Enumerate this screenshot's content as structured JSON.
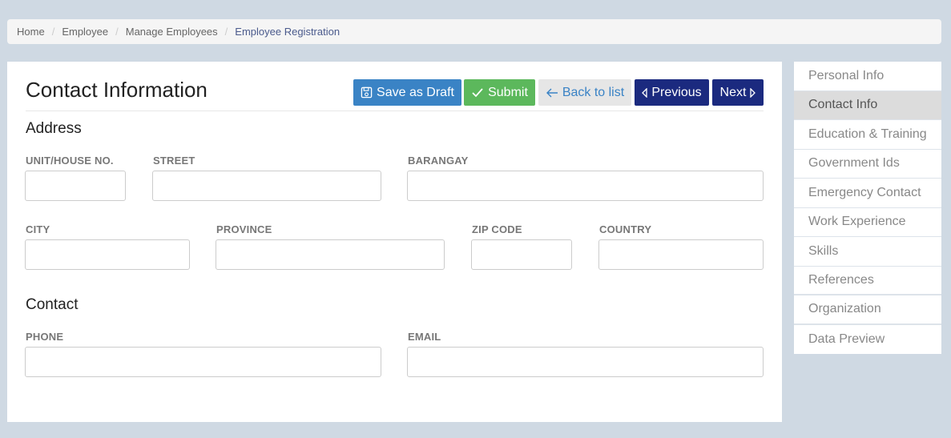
{
  "breadcrumb": {
    "items": [
      "Home",
      "Employee",
      "Manage Employees"
    ],
    "active": "Employee Registration",
    "separator": "/"
  },
  "main": {
    "title": "Contact Information",
    "buttons": {
      "save_draft": "Save as Draft",
      "submit": "Submit",
      "back": "Back to list",
      "previous": "Previous",
      "next": "Next"
    },
    "address": {
      "heading": "Address",
      "unit_label": "UNIT/HOUSE NO.",
      "street_label": "STREET",
      "barangay_label": "BARANGAY",
      "city_label": "CITY",
      "province_label": "PROVINCE",
      "zip_label": "ZIP CODE",
      "country_label": "COUNTRY"
    },
    "contact": {
      "heading": "Contact",
      "phone_label": "PHONE",
      "email_label": "EMAIL"
    }
  },
  "sidebar": {
    "items": [
      "Personal Info",
      "Contact Info",
      "Education & Training",
      "Government Ids",
      "Emergency Contact",
      "Work Experience",
      "Skills",
      "References",
      "Organization",
      "Data Preview"
    ],
    "active_index": 1
  },
  "colors": {
    "primary": "#3a83c5",
    "success": "#5cb85c",
    "navy": "#1b2a7f",
    "page_bg": "#cfd9e3"
  }
}
